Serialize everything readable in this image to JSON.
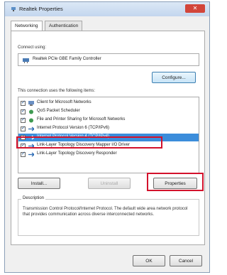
{
  "window": {
    "title": "Realtek Properties",
    "close_glyph": "✕"
  },
  "tabs": [
    {
      "label": "Networking",
      "active": true
    },
    {
      "label": "Authentication",
      "active": false
    }
  ],
  "connect_using": {
    "label": "Connect using:",
    "adapter": "Realtek PCIe GBE Family Controller",
    "adapter_icon": "network-adapter-icon"
  },
  "buttons": {
    "configure": "Configure...",
    "install": "Install...",
    "uninstall": "Uninstall",
    "properties": "Properties",
    "ok": "OK",
    "cancel": "Cancel"
  },
  "items_label": "This connection uses the following items:",
  "items": [
    {
      "label": "Client for Microsoft Networks",
      "checked": true,
      "icon": "client-icon"
    },
    {
      "label": "QoS Packet Scheduler",
      "checked": true,
      "icon": "service-icon"
    },
    {
      "label": "File and Printer Sharing for Microsoft Networks",
      "checked": true,
      "icon": "service-icon"
    },
    {
      "label": "Internet Protocol Version 6 (TCP/IPv6)",
      "checked": true,
      "icon": "protocol-icon"
    },
    {
      "label": "Internet Protocol Version 4 (TCP/IPv4)",
      "checked": true,
      "icon": "protocol-icon",
      "selected": true
    },
    {
      "label": "Link-Layer Topology Discovery Mapper I/O Driver",
      "checked": true,
      "icon": "protocol-icon"
    },
    {
      "label": "Link-Layer Topology Discovery Responder",
      "checked": true,
      "icon": "protocol-icon"
    }
  ],
  "description": {
    "title": "Description",
    "text": "Transmission Control Protocol/Internet Protocol. The default wide area network protocol that provides communication across diverse interconnected networks."
  },
  "colors": {
    "highlight": "#d3122c",
    "selection": "#3b8ddb"
  }
}
